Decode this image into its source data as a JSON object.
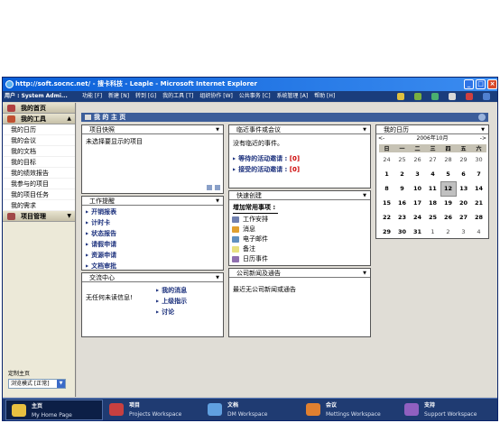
{
  "window": {
    "title": "http://soft.socnc.net/ - 搜卡科技 - Leaple - Microsoft Internet Explorer",
    "min": "_",
    "max": "□",
    "close": "×"
  },
  "menubar": {
    "user": "用户 : System Admi...",
    "items": [
      "功能 [F]",
      "新建 [N]",
      "转到 [G]",
      "我的工具 [T]",
      "组织协作 [W]",
      "公共事务 [C]",
      "系统管理 [A]",
      "帮助 [H]"
    ]
  },
  "sidebar": {
    "home": "我的首页",
    "tools_header": "我的工具",
    "tools_items": [
      "我的日历",
      "我的会议",
      "我的文档",
      "我的目标",
      "我的绩效报告",
      "我参与的项目",
      "我的项目任务",
      "我的需求"
    ],
    "project_header": "项目管理",
    "footer_label": "定制主页",
    "footer_select": "浏览模式 [正常]"
  },
  "page": {
    "title": "我 的 主 页"
  },
  "panels": {
    "project_express": {
      "title": "项目快照",
      "text": "未选择要显示的项目"
    },
    "recent_events": {
      "title": "临近事件或会议",
      "text": "没有临近的事件。",
      "links": [
        {
          "label": "等待的活动邀请 : ",
          "count": "[0]"
        },
        {
          "label": "接受的活动邀请 : ",
          "count": "[0]"
        }
      ]
    },
    "calendar": {
      "title": "我的日历",
      "month": "2006年10月",
      "prev": "<-",
      "next": "->",
      "weekdays": [
        "日",
        "一",
        "二",
        "三",
        "四",
        "五",
        "六"
      ],
      "today": "12",
      "weeks": [
        [
          "24",
          "25",
          "26",
          "27",
          "28",
          "29",
          "30"
        ],
        [
          "1",
          "2",
          "3",
          "4",
          "5",
          "6",
          "7"
        ],
        [
          "8",
          "9",
          "10",
          "11",
          "12",
          "13",
          "14"
        ],
        [
          "15",
          "16",
          "17",
          "18",
          "19",
          "20",
          "21"
        ],
        [
          "22",
          "23",
          "24",
          "25",
          "26",
          "27",
          "28"
        ],
        [
          "29",
          "30",
          "31",
          "1",
          "2",
          "3",
          "4"
        ]
      ]
    },
    "work_reminder": {
      "title": "工作提醒",
      "links": [
        "开销报表",
        "计时卡",
        "状态报告",
        "请假申请",
        "资源申请",
        "文档审批"
      ]
    },
    "quick_create": {
      "title": "快速创建",
      "subtitle": "增加常用事项 :",
      "items": [
        "工作安排",
        "消息",
        "电子邮件",
        "备注",
        "日历事件"
      ]
    },
    "exchange": {
      "title": "交流中心",
      "text": "无任何未读信息!",
      "links": [
        "我的消息",
        "上级指示",
        "讨论"
      ]
    },
    "news": {
      "title": "公司新闻及通告",
      "text": "最近无公司新闻或通告"
    }
  },
  "taskbar": [
    {
      "title": "主页",
      "subtitle": "My Home Page",
      "color": "#e8c040"
    },
    {
      "title": "项目",
      "subtitle": "Projects Workspace",
      "color": "#c84040"
    },
    {
      "title": "文档",
      "subtitle": "DM Workspace",
      "color": "#60a0e0"
    },
    {
      "title": "会议",
      "subtitle": "Mettings Workspace",
      "color": "#e08030"
    },
    {
      "title": "支持",
      "subtitle": "Support Workspace",
      "color": "#9060c0"
    }
  ]
}
